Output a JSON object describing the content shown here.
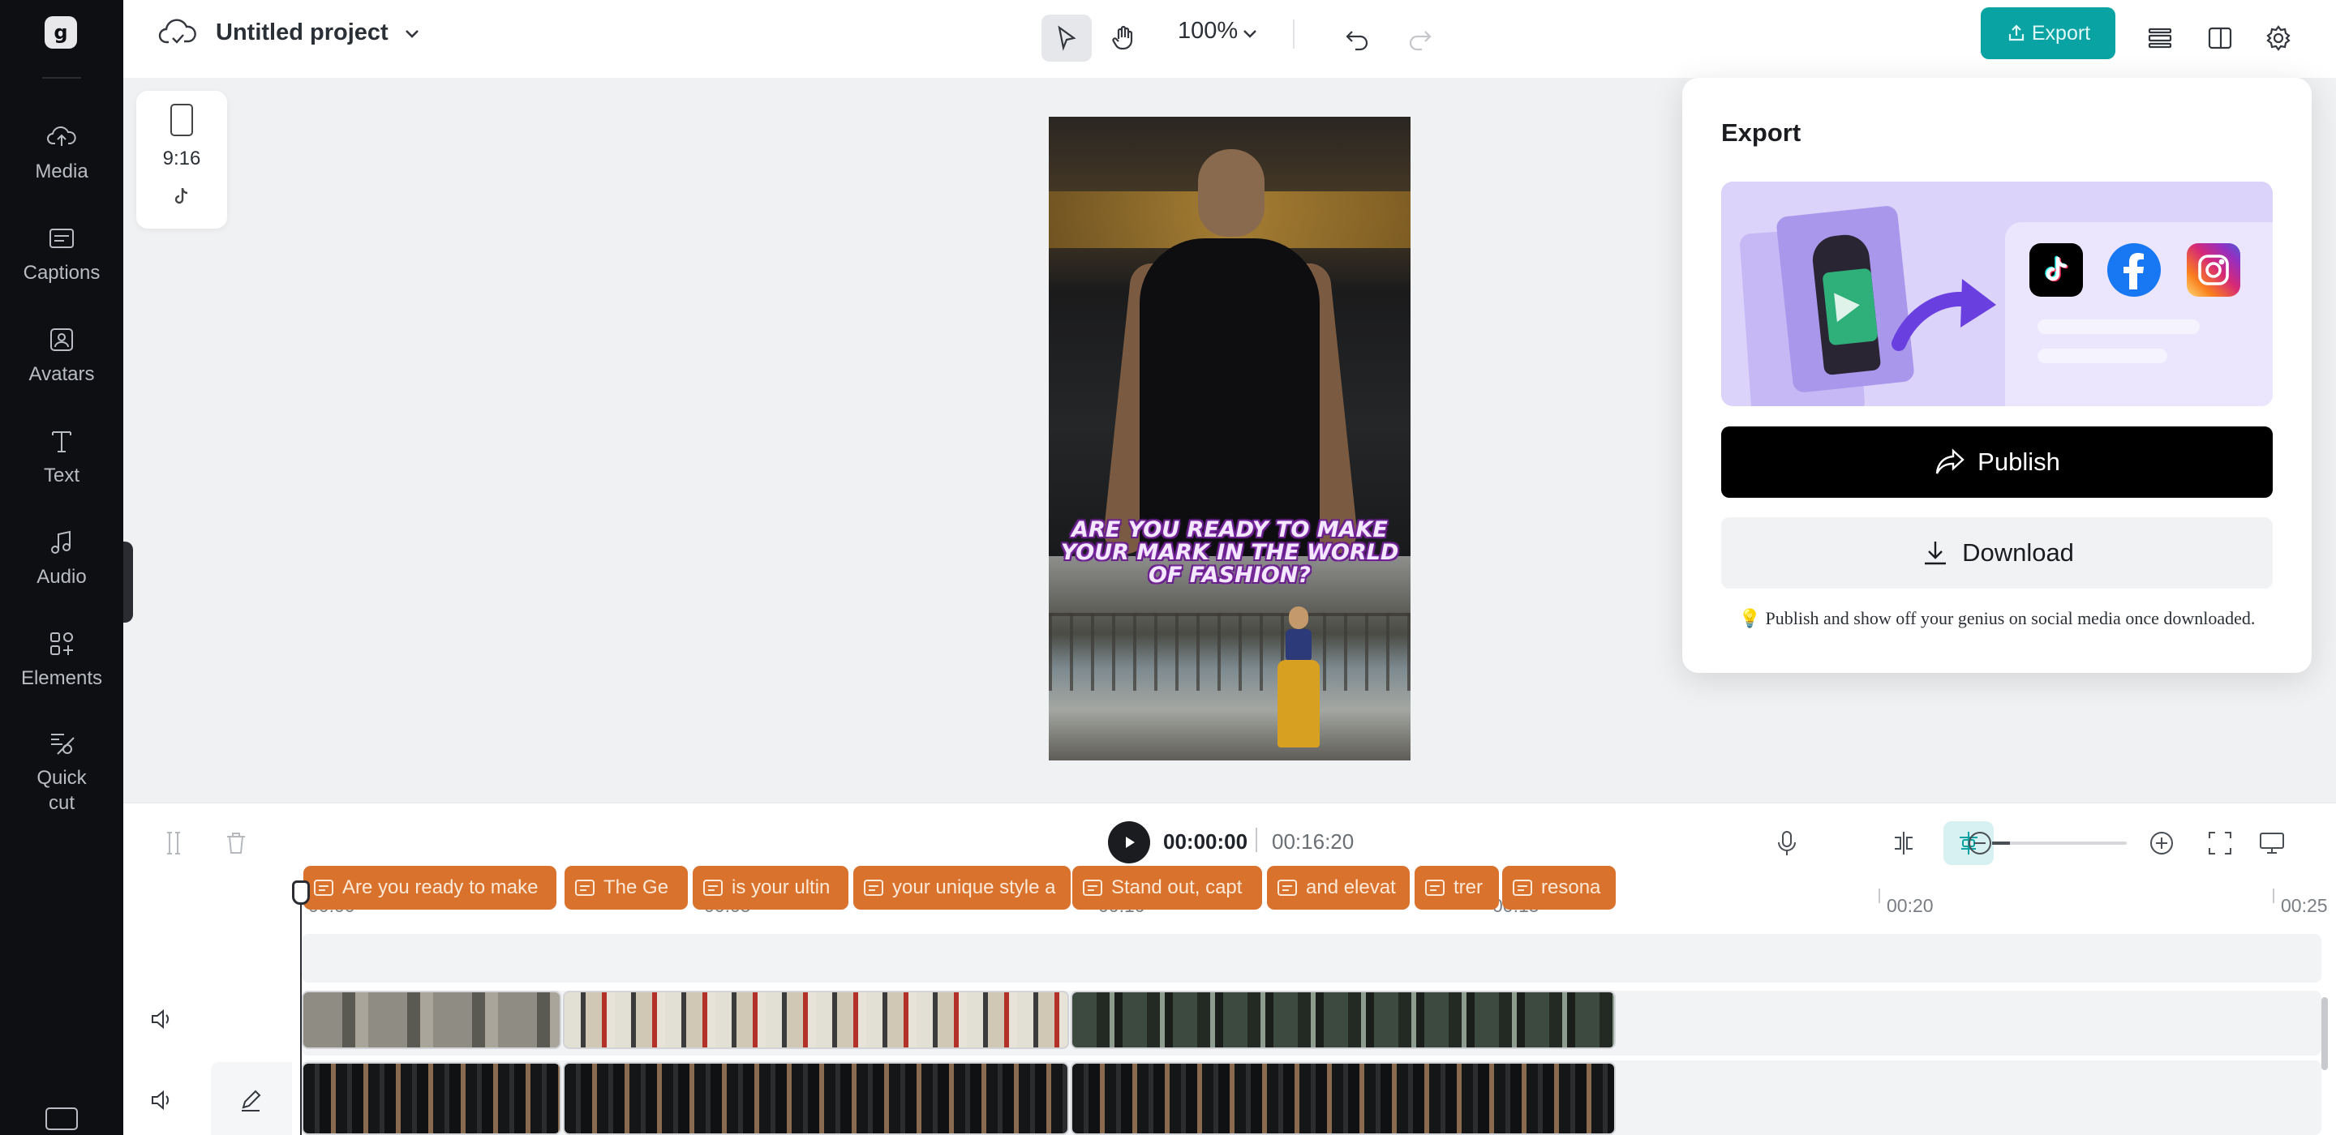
{
  "rail": {
    "logo": "g",
    "items": [
      {
        "label": "Media",
        "icon": "cloud-upload-icon"
      },
      {
        "label": "Captions",
        "icon": "captions-icon"
      },
      {
        "label": "Avatars",
        "icon": "avatar-icon"
      },
      {
        "label": "Text",
        "icon": "text-icon"
      },
      {
        "label": "Audio",
        "icon": "music-note-icon"
      },
      {
        "label": "Elements",
        "icon": "elements-grid-icon"
      },
      {
        "label": "Quick cut",
        "icon": "quick-cut-icon"
      }
    ]
  },
  "topbar": {
    "project_title": "Untitled project",
    "zoom": "100%",
    "export_label": "Export"
  },
  "canvas": {
    "aspect_ratio": "9:16",
    "caption_text": "ARE YOU READY TO MAKE YOUR MARK IN THE WORLD OF FASHION?"
  },
  "playback": {
    "current_time": "00:00:00",
    "total_time": "00:16:20",
    "zoom_level_fraction": 0.13
  },
  "timeline": {
    "ruler": [
      "00:00",
      "00:05",
      "00:10",
      "00:15",
      "00:20",
      "00:25"
    ],
    "captions": [
      "Are you ready to make",
      "The Ge",
      "is your ultin",
      "your unique style a",
      "Stand out, capt",
      "and elevat",
      "trer",
      "resona"
    ]
  },
  "export_popover": {
    "title": "Export",
    "publish_label": "Publish",
    "download_label": "Download",
    "hint": "💡 Publish and show off your genius on social media once downloaded."
  },
  "colors": {
    "accent": "#0aa3a3",
    "caption_chip": "#d9722d",
    "rail_bg": "#0e0f12",
    "publish_bg": "#000000"
  }
}
